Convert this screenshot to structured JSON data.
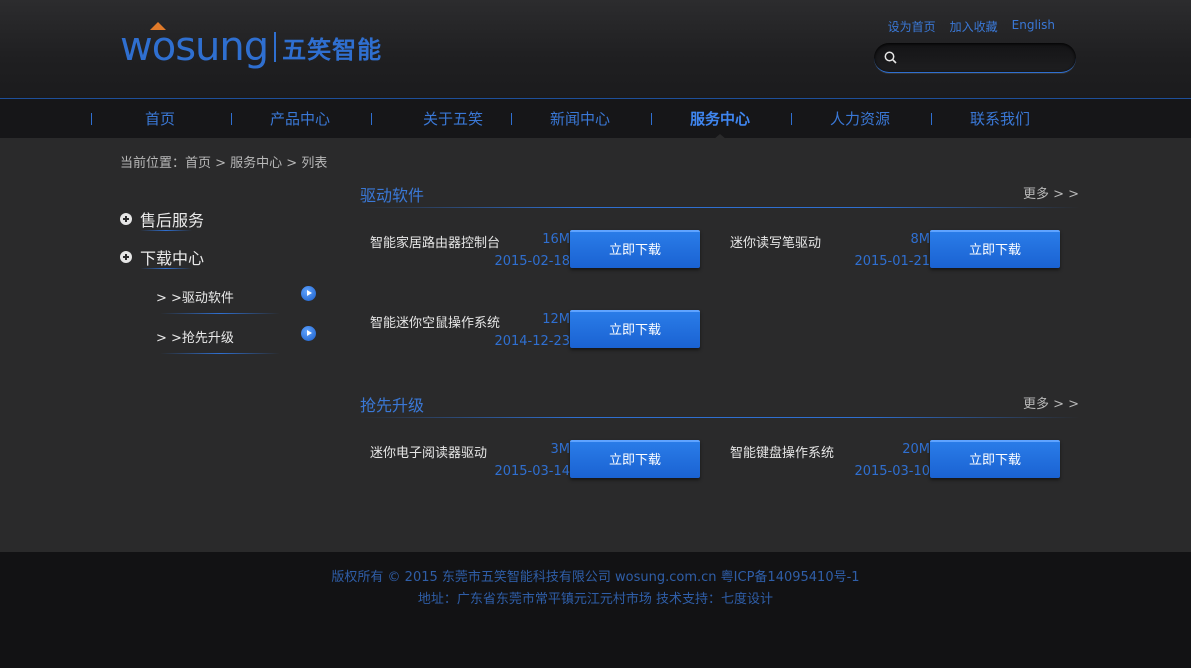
{
  "brand": {
    "logo_word": "wosung",
    "logo_cn": "五笑智能",
    "accent": "#2f6fd0",
    "logo_accent": "#e07a2a"
  },
  "toplinks": [
    "设为首页",
    "加入收藏",
    "English"
  ],
  "search": {
    "placeholder": ""
  },
  "nav": {
    "items": [
      "首页",
      "产品中心",
      "关于五笑",
      "新闻中心",
      "服务中心",
      "人力资源",
      "联系我们"
    ],
    "active": "服务中心"
  },
  "breadcrumb": "当前位置：首页 > 服务中心 > 列表",
  "sidebar": {
    "categories": [
      {
        "label": "售后服务"
      },
      {
        "label": "下载中心",
        "subs": [
          "> >驱动软件",
          "> >抢先升级"
        ]
      }
    ]
  },
  "sections": [
    {
      "title": "驱动软件",
      "more": "更多 > >",
      "items": [
        {
          "name": "智能家居路由器控制台",
          "size": "16M",
          "date": "2015-02-18",
          "button": "立即下载"
        },
        {
          "name": "迷你读写笔驱动",
          "size": "8M",
          "date": "2015-01-21",
          "button": "立即下载"
        },
        {
          "name": "智能迷你空鼠操作系统",
          "size": "12M",
          "date": "2014-12-23",
          "button": "立即下载"
        }
      ]
    },
    {
      "title": "抢先升级",
      "more": "更多 > >",
      "items": [
        {
          "name": "迷你电子阅读器驱动",
          "size": "3M",
          "date": "2015-03-14",
          "button": "立即下载"
        },
        {
          "name": "智能键盘操作系统",
          "size": "20M",
          "date": "2015-03-10",
          "button": "立即下载"
        }
      ]
    }
  ],
  "footer": {
    "line1": "版权所有 © 2015 东莞市五笑智能科技有限公司 wosung.com.cn 粤ICP备14095410号-1",
    "line2": "地址：广东省东莞市常平镇元江元村市场   技术支持：七度设计"
  }
}
